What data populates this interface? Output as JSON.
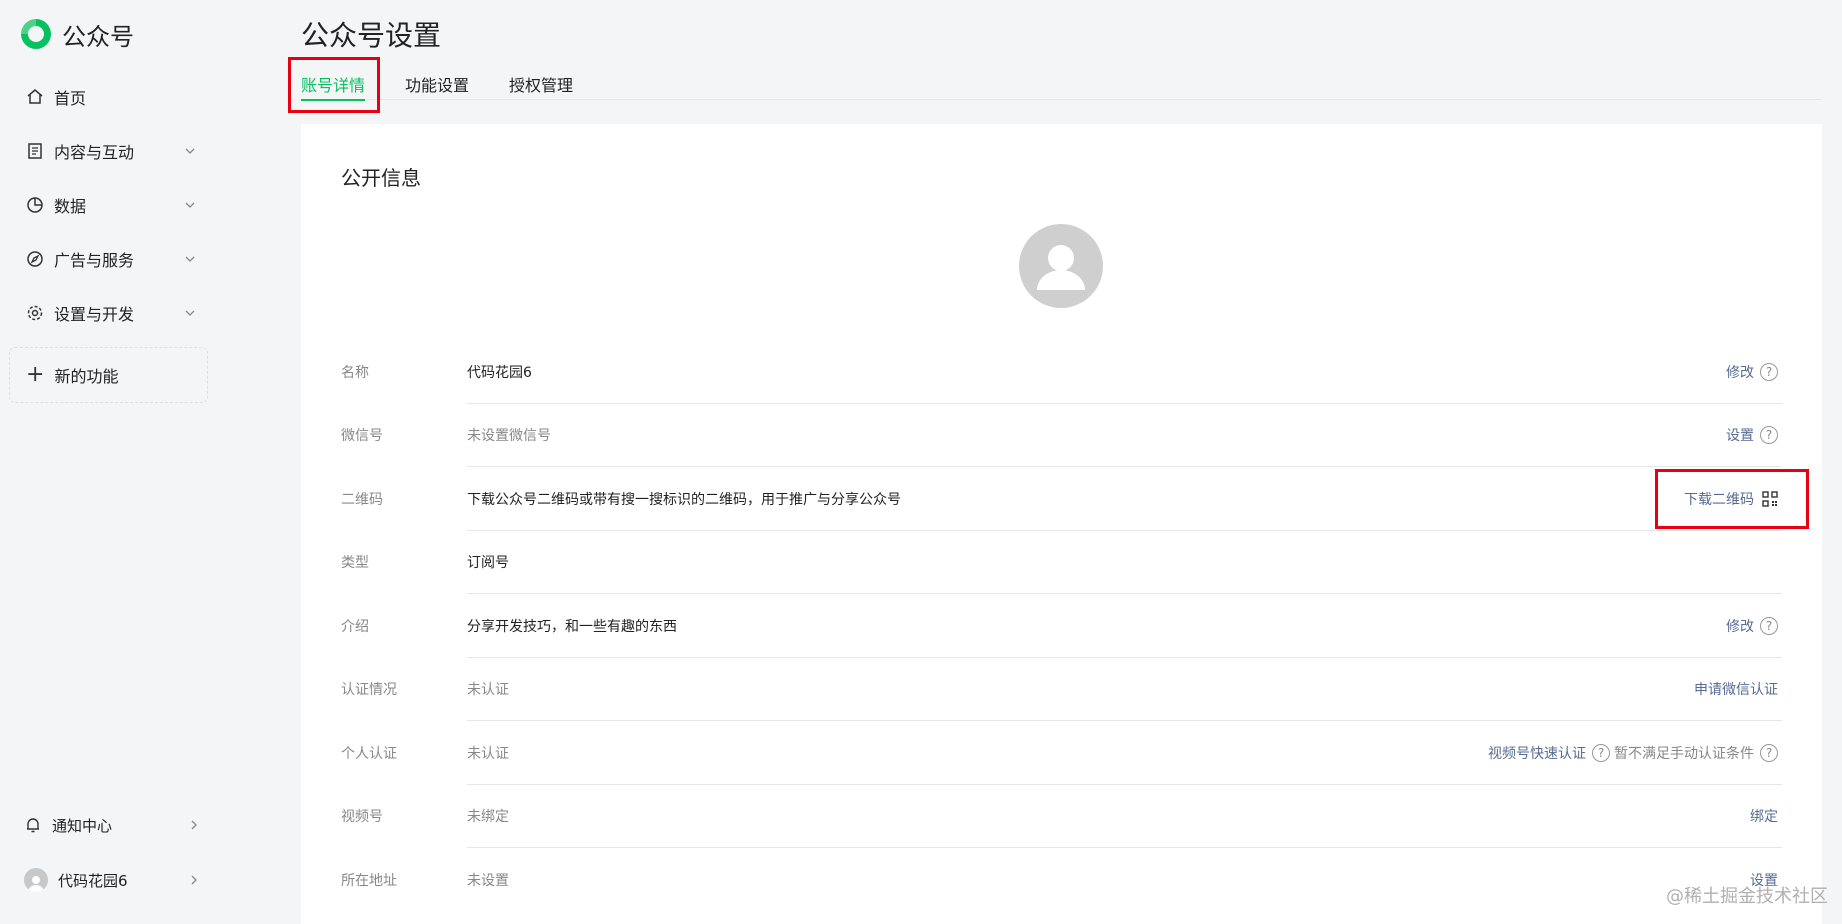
{
  "app": {
    "name": "公众号"
  },
  "sidebar": {
    "items": [
      {
        "label": "首页",
        "icon": "home-icon"
      },
      {
        "label": "内容与互动",
        "icon": "document-icon"
      },
      {
        "label": "数据",
        "icon": "pie-chart-icon"
      },
      {
        "label": "广告与服务",
        "icon": "compass-icon"
      },
      {
        "label": "设置与开发",
        "icon": "gear-icon"
      }
    ],
    "new_features": "新的功能",
    "notifications": "通知中心",
    "account_name": "代码花园6"
  },
  "page": {
    "title": "公众号设置",
    "tabs": [
      "账号详情",
      "功能设置",
      "授权管理"
    ],
    "active_tab": "账号详情"
  },
  "public_info": {
    "title": "公开信息",
    "rows": [
      {
        "label": "名称",
        "value": "代码花园6",
        "action": "修改",
        "help": "?"
      },
      {
        "label": "微信号",
        "value": "未设置微信号",
        "action": "设置",
        "help": "?"
      },
      {
        "label": "二维码",
        "value": "下载公众号二维码或带有搜一搜标识的二维码，用于推广与分享公众号",
        "action": "下载二维码"
      },
      {
        "label": "类型",
        "value": "订阅号"
      },
      {
        "label": "介绍",
        "value": "分享开发技巧，和一些有趣的东西",
        "action": "修改",
        "help": "?"
      },
      {
        "label": "认证情况",
        "value": "未认证",
        "action": "申请微信认证"
      },
      {
        "label": "个人认证",
        "value": "未认证",
        "action": "视频号快速认证",
        "help": "?",
        "note": "暂不满足手动认证条件",
        "note_help": "?"
      },
      {
        "label": "视频号",
        "value": "未绑定",
        "action": "绑定"
      },
      {
        "label": "所在地址",
        "value": "未设置",
        "action": "设置"
      }
    ]
  },
  "watermark": "@稀土掘金技术社区",
  "colors": {
    "accent": "#07c160",
    "link": "#576b95",
    "highlight": "#e60012"
  }
}
